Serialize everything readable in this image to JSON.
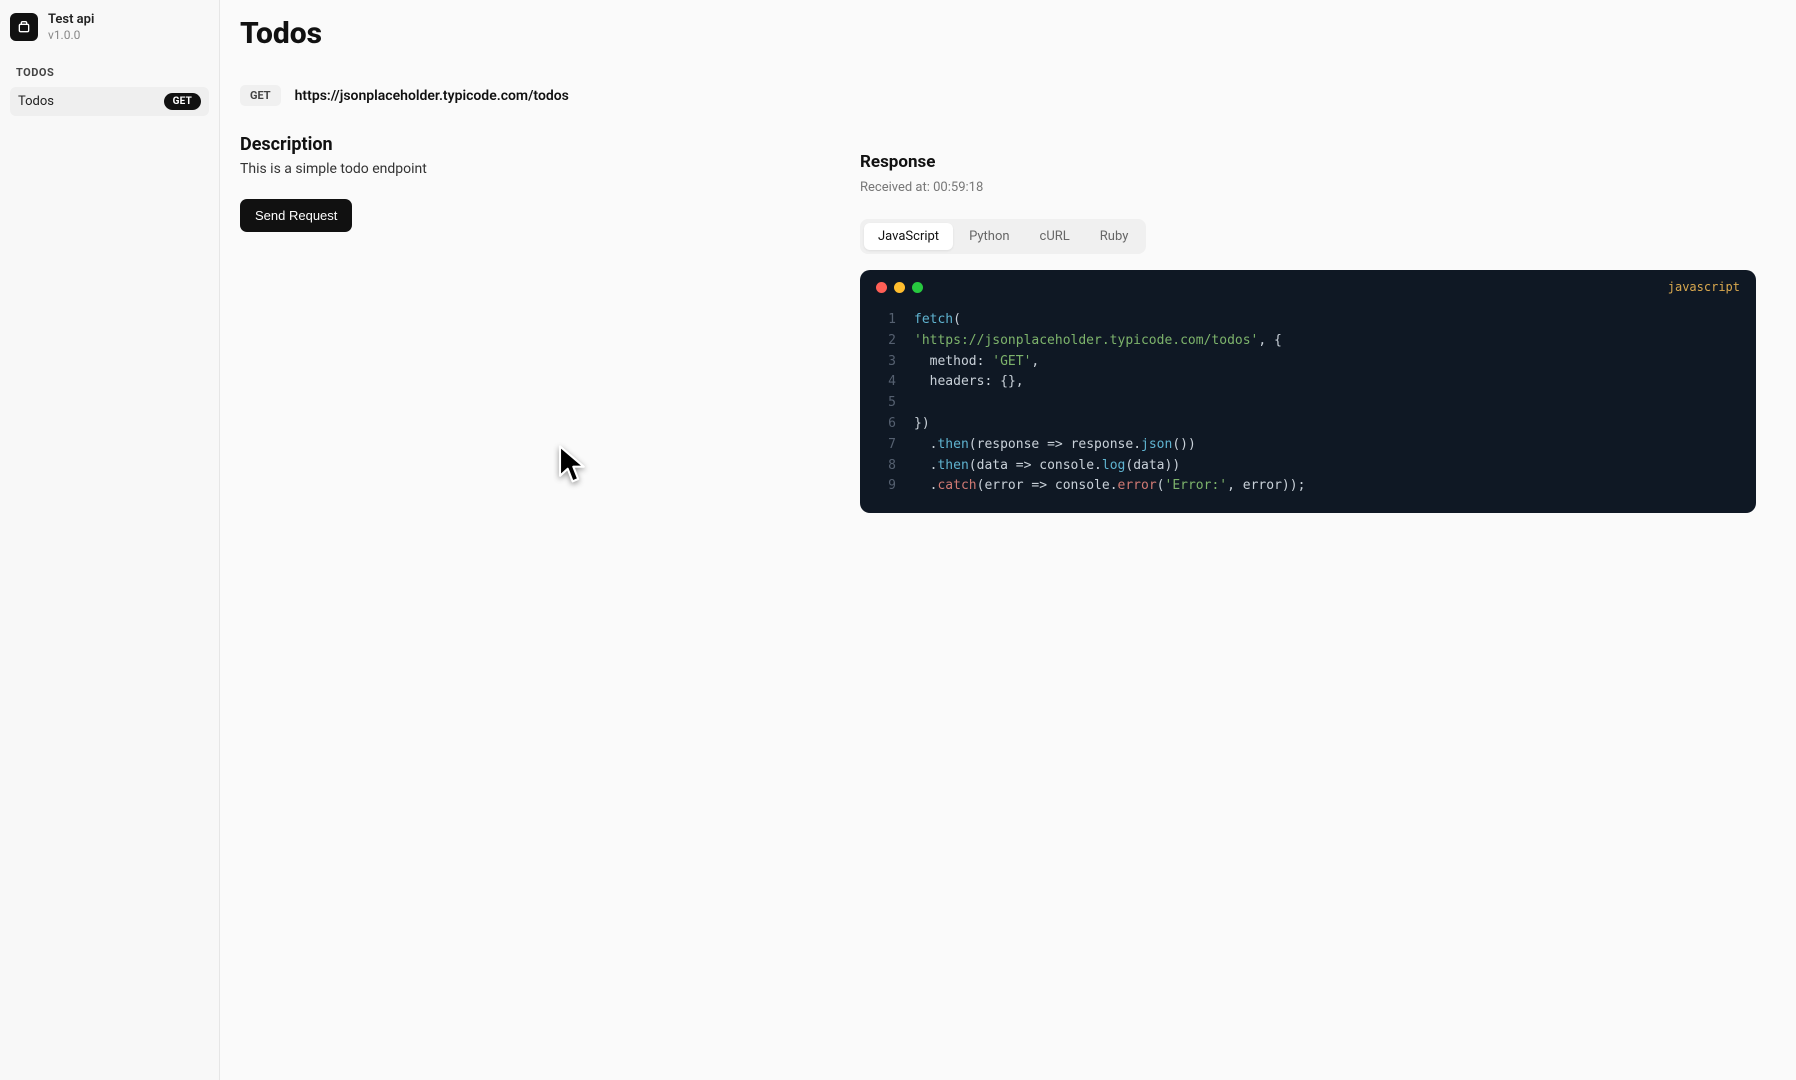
{
  "app": {
    "title": "Test api",
    "version": "v1.0.0"
  },
  "sidebar": {
    "section_label": "TODOS",
    "items": [
      {
        "label": "Todos",
        "method": "GET"
      }
    ]
  },
  "page": {
    "title": "Todos",
    "endpoint_method": "GET",
    "endpoint_url": "https://jsonplaceholder.typicode.com/todos"
  },
  "description": {
    "heading": "Description",
    "text": "This is a simple todo endpoint",
    "send_button": "Send Request"
  },
  "response": {
    "heading": "Response",
    "received_label": "Received at: 00:59:18",
    "tabs": [
      "JavaScript",
      "Python",
      "cURL",
      "Ruby"
    ],
    "active_tab_index": 0,
    "code_lang_badge": "javascript",
    "code_lines": [
      "fetch(",
      "'https://jsonplaceholder.typicode.com/todos', {",
      "  method: 'GET',",
      "  headers: {},",
      "",
      "})",
      "  .then(response => response.json())",
      "  .then(data => console.log(data))",
      "  .catch(error => console.error('Error:', error));"
    ]
  }
}
